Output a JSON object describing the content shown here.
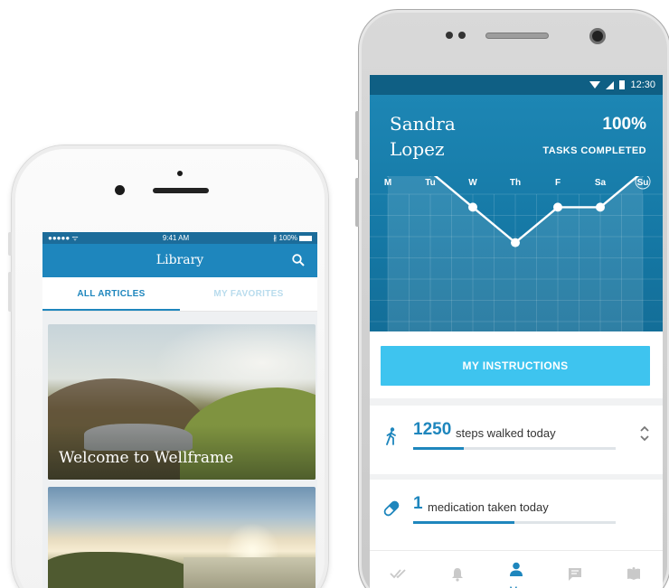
{
  "iphone": {
    "status": {
      "signal": "●●●●● ᯤ",
      "time": "9:41 AM",
      "battery": "∦ 100%"
    },
    "header": {
      "title": "Library",
      "search_icon": "search-icon"
    },
    "tabs": [
      {
        "label": "ALL ARTICLES",
        "active": true
      },
      {
        "label": "MY FAVORITES",
        "active": false
      }
    ],
    "articles": [
      {
        "caption": "Welcome to Wellframe",
        "image": "mountain-hiker-landscape"
      },
      {
        "caption": "",
        "image": "coastal-sunrise-landscape"
      }
    ]
  },
  "android": {
    "status": {
      "time": "12:30"
    },
    "profile": {
      "name_first": "Sandra",
      "name_last": "Lopez",
      "percent": "100%",
      "tasks_label": "TASKS COMPLETED"
    },
    "chart_data": {
      "type": "line",
      "categories": [
        "M",
        "Tu",
        "W",
        "Th",
        "F",
        "Sa",
        "Su"
      ],
      "values": [
        4,
        4,
        3,
        2,
        3,
        3,
        4
      ],
      "highlighted_category": "Su",
      "ylim": [
        0,
        5
      ],
      "grid": true
    },
    "instructions_button": "MY INSTRUCTIONS",
    "stats": [
      {
        "number": "1250",
        "label": "steps walked today",
        "progress": 0.25,
        "icon": "walking-person-icon"
      },
      {
        "number": "1",
        "label": "medication taken today",
        "progress": 0.5,
        "icon": "pill-icon"
      }
    ],
    "nav": [
      {
        "icon": "double-check-icon",
        "label": ""
      },
      {
        "icon": "bell-icon",
        "label": ""
      },
      {
        "icon": "person-icon",
        "label": "Me",
        "active": true
      },
      {
        "icon": "chat-icon",
        "label": ""
      },
      {
        "icon": "book-icon",
        "label": ""
      }
    ],
    "colors": {
      "primary": "#1e86bd",
      "accent": "#3ec4ef",
      "status": "#0f5f84"
    }
  }
}
